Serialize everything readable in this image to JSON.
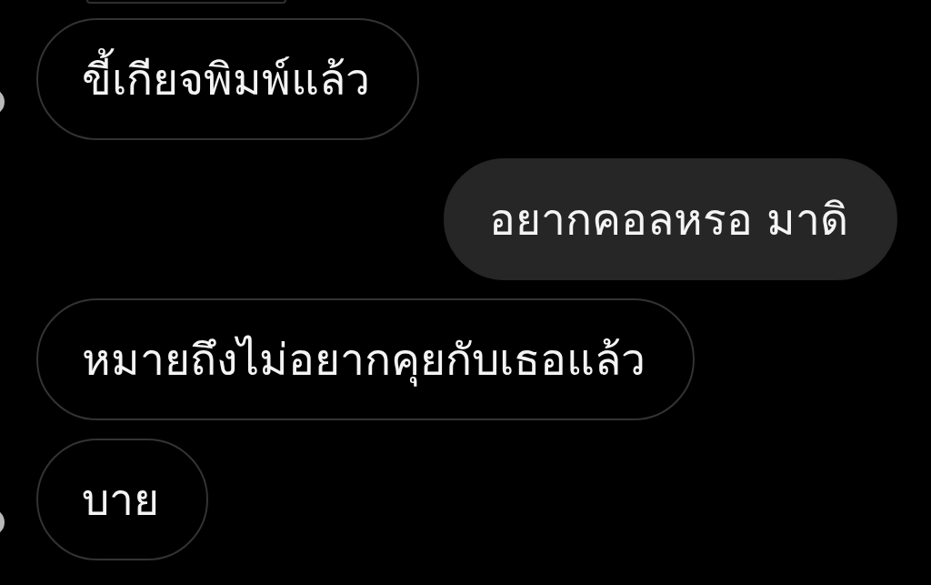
{
  "messages": [
    {
      "kind": "cut_off"
    },
    {
      "kind": "incoming",
      "avatar": true,
      "text": "ขี้เกียจพิมพ์แล้ว"
    },
    {
      "kind": "outgoing",
      "text": "อยากคอลหรอ มาดิ"
    },
    {
      "kind": "incoming",
      "avatar": false,
      "text": "หมายถึงไม่อยากคุยกับเธอแล้ว"
    },
    {
      "kind": "incoming",
      "avatar": true,
      "text": "บาย"
    }
  ]
}
